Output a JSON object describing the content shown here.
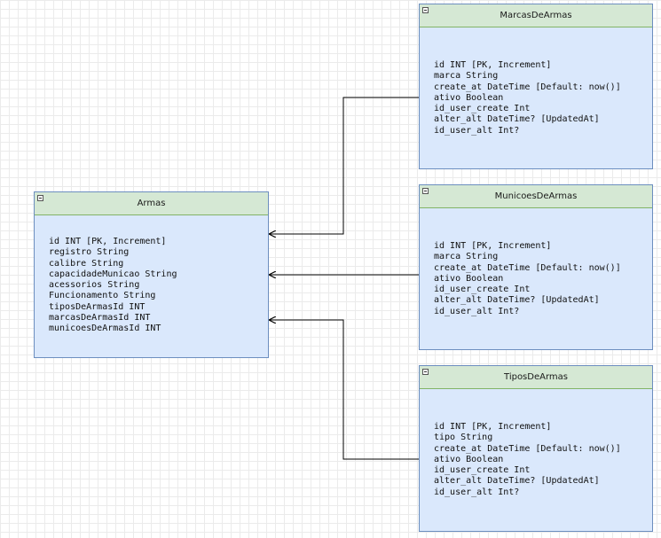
{
  "entities": {
    "armas": {
      "title": "Armas",
      "fields": [
        "id INT [PK, Increment]",
        "registro String",
        "calibre String",
        "capacidadeMunicao String",
        "acessorios String",
        "Funcionamento String",
        "tiposDeArmasId INT",
        "marcasDeArmasId INT",
        "municoesDeArmasId INT"
      ]
    },
    "marcas": {
      "title": "MarcasDeArmas",
      "fields": [
        "id INT [PK, Increment]",
        "marca String",
        "create_at DateTime [Default: now()]",
        "ativo Boolean",
        "id_user_create Int",
        "alter_alt DateTime? [UpdatedAt]",
        "id_user_alt Int?"
      ]
    },
    "municoes": {
      "title": "MunicoesDeArmas",
      "fields": [
        "id INT [PK, Increment]",
        "marca String",
        "create_at DateTime [Default: now()]",
        "ativo Boolean",
        "id_user_create Int",
        "alter_alt DateTime? [UpdatedAt]",
        "id_user_alt Int?"
      ]
    },
    "tipos": {
      "title": "TiposDeArmas",
      "fields": [
        "id INT [PK, Increment]",
        "tipo String",
        "create_at DateTime [Default: now()]",
        "ativo Boolean",
        "id_user_create Int",
        "alter_alt DateTime? [UpdatedAt]",
        "id_user_alt Int?"
      ]
    }
  },
  "colors": {
    "header_fill": "#d5e8d4",
    "header_border": "#82b366",
    "body_fill": "#dae8fc",
    "body_border": "#6c8ebf",
    "connector": "#000000"
  }
}
